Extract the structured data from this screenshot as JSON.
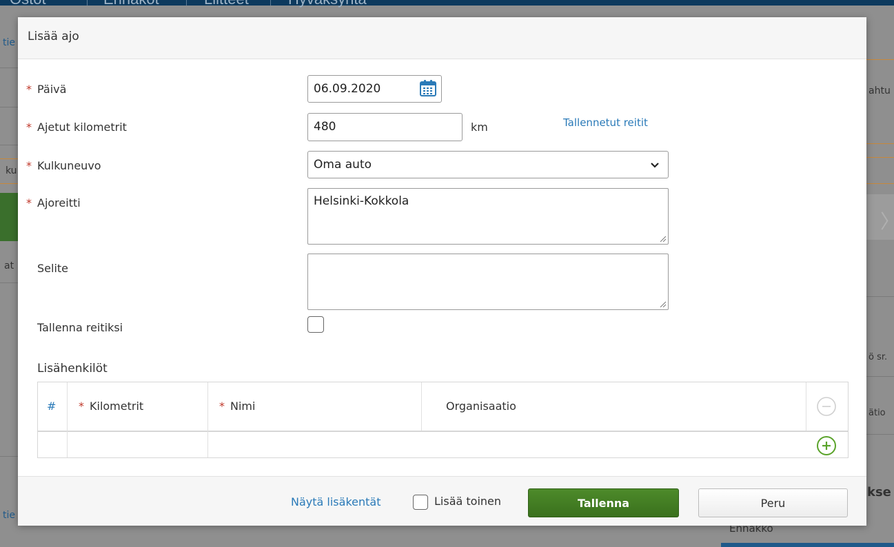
{
  "background": {
    "tabs": [
      "Ostot",
      "Ennakot",
      "Liitteet",
      "Hyväksyntä"
    ],
    "left_fragments": [
      "tie",
      "ku",
      "at",
      "tie"
    ],
    "right_fragments": [
      "ahtu",
      "ö sr.",
      "ätio",
      "kse",
      "Ennakko"
    ]
  },
  "modal": {
    "title": "Lisää ajo",
    "fields": {
      "date": {
        "label": "Päivä",
        "value": "06.09.2020"
      },
      "km": {
        "label": "Ajetut kilometrit",
        "value": "480",
        "unit": "km"
      },
      "saved_routes_link": "Tallennetut reitit",
      "vehicle": {
        "label": "Kulkuneuvo",
        "selected": "Oma auto"
      },
      "route": {
        "label": "Ajoreitti",
        "value": "Helsinki-Kokkola"
      },
      "description": {
        "label": "Selite",
        "value": ""
      },
      "save_route": {
        "label": "Tallenna reitiksi",
        "checked": false
      }
    },
    "extra_persons": {
      "title": "Lisähenkilöt",
      "columns": {
        "index": "#",
        "km": "Kilometrit",
        "name": "Nimi",
        "org": "Organisaatio"
      }
    },
    "footer": {
      "show_more_link": "Näytä lisäkentät",
      "add_another_label": "Lisää toinen",
      "save_button": "Tallenna",
      "cancel_button": "Peru"
    }
  },
  "colors": {
    "primary_button": "#3f7a22",
    "link": "#2a7ab8",
    "required": "#c0392b",
    "add_icon": "#5aa32a"
  },
  "icons": [
    "calendar-icon",
    "chevron-down-icon",
    "remove-row-icon",
    "add-row-icon",
    "resize-grip-icon"
  ]
}
